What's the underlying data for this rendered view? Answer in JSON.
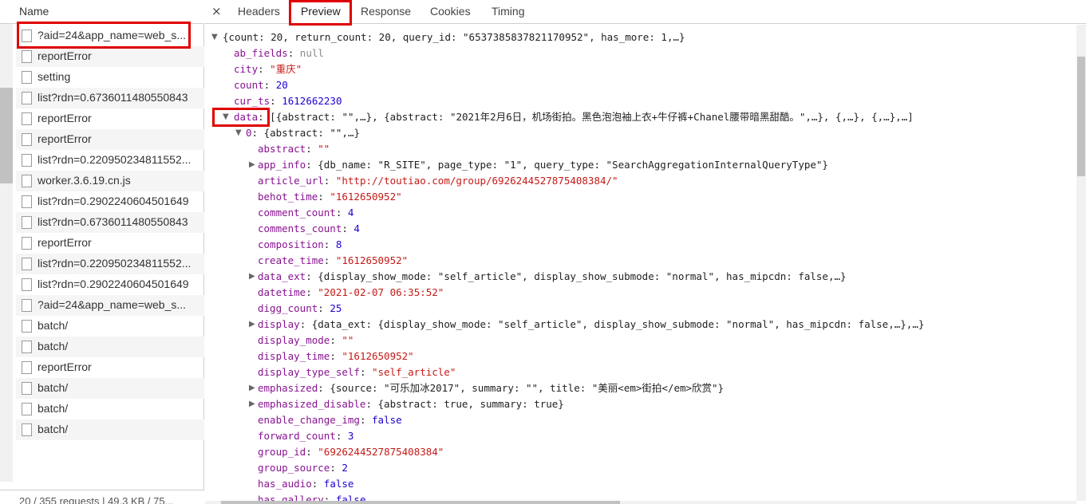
{
  "left_panel": {
    "header": "Name",
    "requests": [
      {
        "name": "?aid=24&app_name=web_s..."
      },
      {
        "name": "reportError"
      },
      {
        "name": "setting"
      },
      {
        "name": "list?rdn=0.6736011480550843"
      },
      {
        "name": "reportError"
      },
      {
        "name": "reportError"
      },
      {
        "name": "list?rdn=0.220950234811552..."
      },
      {
        "name": "worker.3.6.19.cn.js"
      },
      {
        "name": "list?rdn=0.2902240604501649"
      },
      {
        "name": "list?rdn=0.6736011480550843"
      },
      {
        "name": "reportError"
      },
      {
        "name": "list?rdn=0.220950234811552..."
      },
      {
        "name": "list?rdn=0.2902240604501649"
      },
      {
        "name": "?aid=24&app_name=web_s..."
      },
      {
        "name": "batch/"
      },
      {
        "name": "batch/"
      },
      {
        "name": "reportError"
      },
      {
        "name": "batch/"
      },
      {
        "name": "batch/"
      },
      {
        "name": "batch/"
      }
    ],
    "footer": "20 / 355 requests | 49.3 KB / 75..."
  },
  "tabs": {
    "close": "×",
    "headers": "Headers",
    "preview": "Preview",
    "response": "Response",
    "cookies": "Cookies",
    "timing": "Timing"
  },
  "preview": {
    "summary": "{count: 20, return_count: 20, query_id: \"6537385837821170952\", has_more: 1,…}",
    "ab_fields_key": "ab_fields",
    "ab_fields_val": "null",
    "city_key": "city",
    "city_val": "\"重庆\"",
    "count_key": "count",
    "count_val": "20",
    "cur_ts_key": "cur_ts",
    "cur_ts_val": "1612662230",
    "data_key": "data",
    "data_val": "[{abstract: \"\",…}, {abstract: \"2021年2月6日，机场街拍。黑色泡泡袖上衣+牛仔裤+Chanel腰带暗黑甜酷。\",…}, {,…}, {,…},…]",
    "item0_key": "0",
    "item0_val": "{abstract: \"\",…}",
    "fields": [
      {
        "key": "abstract",
        "val": "\"\"",
        "type": "s"
      },
      {
        "key": "app_info",
        "val": "{db_name: \"R_SITE\", page_type: \"1\", query_type: \"SearchAggregationInternalQueryType\"}",
        "type": "o",
        "expandable": true
      },
      {
        "key": "article_url",
        "val": "\"http://toutiao.com/group/6926244527875408384/\"",
        "type": "s"
      },
      {
        "key": "behot_time",
        "val": "\"1612650952\"",
        "type": "s"
      },
      {
        "key": "comment_count",
        "val": "4",
        "type": "n"
      },
      {
        "key": "comments_count",
        "val": "4",
        "type": "n"
      },
      {
        "key": "composition",
        "val": "8",
        "type": "n"
      },
      {
        "key": "create_time",
        "val": "\"1612650952\"",
        "type": "s"
      },
      {
        "key": "data_ext",
        "val": "{display_show_mode: \"self_article\", display_show_submode: \"normal\", has_mipcdn: false,…}",
        "type": "o",
        "expandable": true
      },
      {
        "key": "datetime",
        "val": "\"2021-02-07 06:35:52\"",
        "type": "s"
      },
      {
        "key": "digg_count",
        "val": "25",
        "type": "n"
      },
      {
        "key": "display",
        "val": "{data_ext: {display_show_mode: \"self_article\", display_show_submode: \"normal\", has_mipcdn: false,…},…}",
        "type": "o",
        "expandable": true
      },
      {
        "key": "display_mode",
        "val": "\"\"",
        "type": "s"
      },
      {
        "key": "display_time",
        "val": "\"1612650952\"",
        "type": "s"
      },
      {
        "key": "display_type_self",
        "val": "\"self_article\"",
        "type": "s"
      },
      {
        "key": "emphasized",
        "val": "{source: \"可乐加冰2017\", summary: \"\", title: \"美丽<em>街拍</em>欣赏\"}",
        "type": "o",
        "expandable": true
      },
      {
        "key": "emphasized_disable",
        "val": "{abstract: true, summary: true}",
        "type": "o",
        "expandable": true
      },
      {
        "key": "enable_change_img",
        "val": "false",
        "type": "n"
      },
      {
        "key": "forward_count",
        "val": "3",
        "type": "n"
      },
      {
        "key": "group_id",
        "val": "\"6926244527875408384\"",
        "type": "s"
      },
      {
        "key": "group_source",
        "val": "2",
        "type": "n"
      },
      {
        "key": "has_audio",
        "val": "false",
        "type": "n"
      },
      {
        "key": "has_gallery",
        "val": "false",
        "type": "n"
      }
    ]
  },
  "colors": {
    "key": "#881391",
    "string": "#c41a16",
    "number": "#1c00cf",
    "highlight": "#e00000"
  }
}
